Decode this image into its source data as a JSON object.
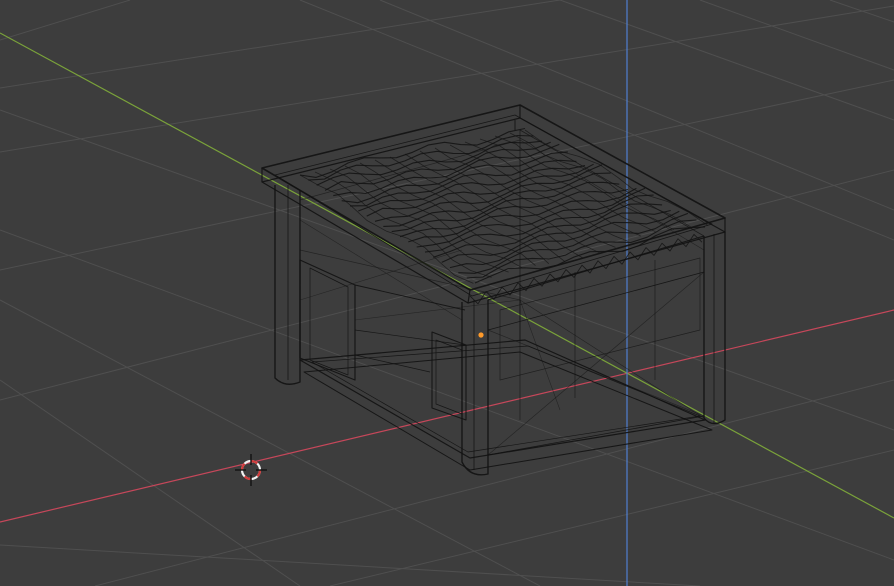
{
  "app": {
    "editor": "3D Viewport",
    "view": "perspective",
    "shading": "wireframe"
  },
  "colors": {
    "background": "#3d3d3d",
    "grid": "#4f4f4f",
    "axis_x": "#c6475a",
    "axis_y": "#7aa23a",
    "axis_z": "#4f7fd0",
    "wire": "#121212",
    "origin": "#ff9a2a",
    "cursor_red": "#d23a3a",
    "cursor_white": "#f2f2f2"
  },
  "scene": {
    "object": "wireframe-cabinet-mesh",
    "has_3d_cursor": true,
    "has_object_origin": true
  }
}
